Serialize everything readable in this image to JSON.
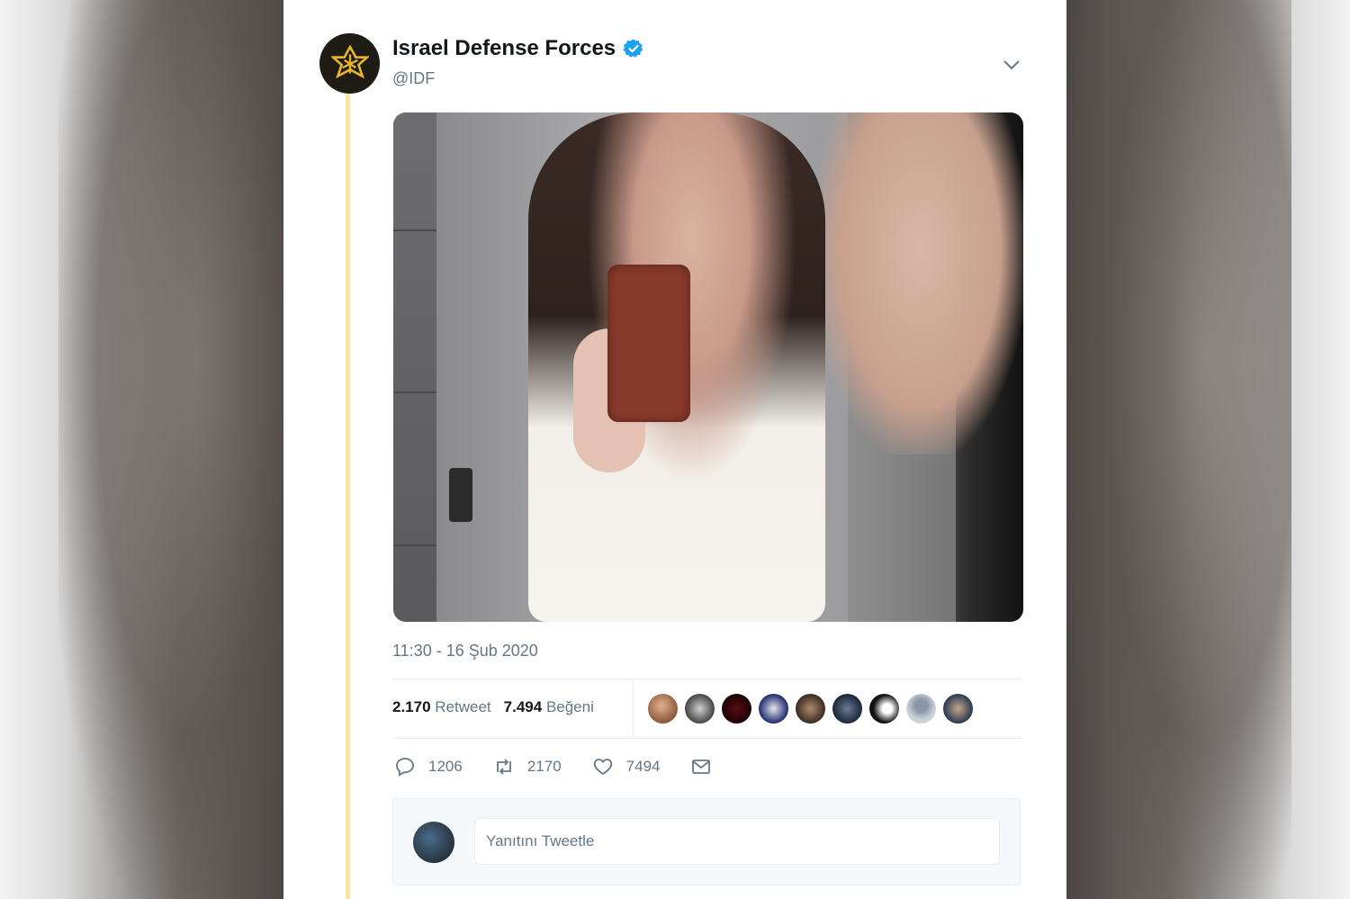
{
  "tweet": {
    "author_name": "Israel Defense Forces",
    "author_handle": "@IDF",
    "timestamp": "11:30 - 16 Şub 2020",
    "retweet_count": "2.170",
    "retweet_label": "Retweet",
    "like_count": "7.494",
    "like_label": "Beğeni",
    "actions": {
      "reply_count": "1206",
      "retweet_count": "2170",
      "like_count": "7494"
    },
    "reply_placeholder": "Yanıtını Tweetle"
  },
  "icons": {
    "verified": "verified-badge-icon",
    "caret": "chevron-down-icon",
    "reply": "reply-icon",
    "retweet": "retweet-icon",
    "like": "heart-icon",
    "message": "envelope-icon"
  },
  "colors": {
    "verified_blue": "#1da1f2",
    "thread_line": "#f6e6a6",
    "muted_text": "#657786",
    "logo_gold": "#e8b52a"
  }
}
